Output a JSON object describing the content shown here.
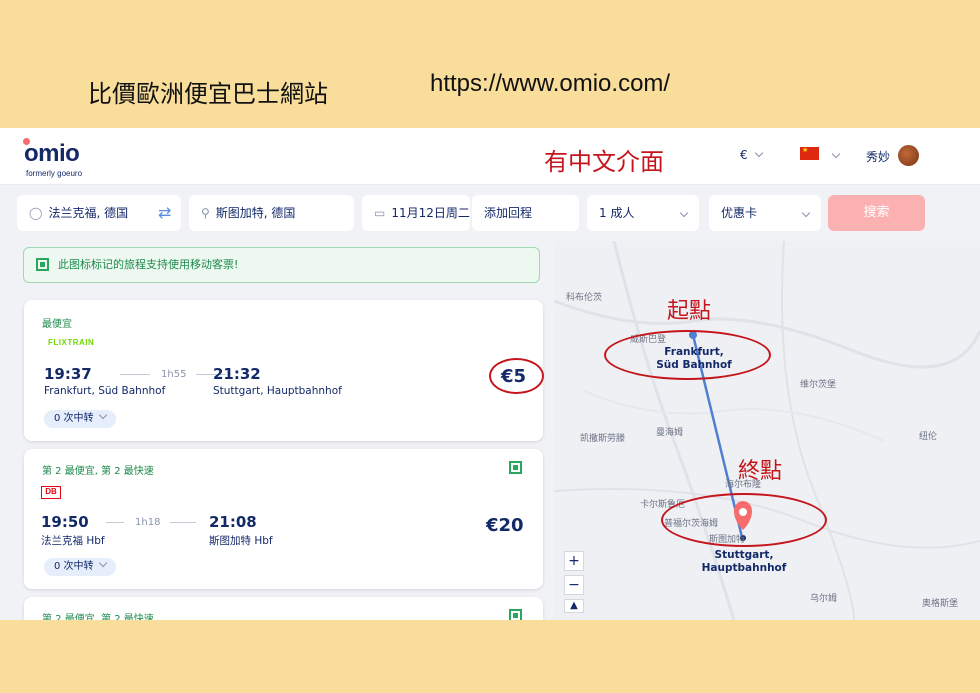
{
  "slide": {
    "title": "比價歐洲便宜巴士網站",
    "url": "https://www.omio.com/"
  },
  "header": {
    "logo": "omio",
    "logo_sub": "formerly goeuro",
    "annotation": "有中文介面",
    "currency": "€",
    "user_name": "秀妙",
    "flag_icon": "china-flag-icon",
    "accent_color": "#132968"
  },
  "search": {
    "from": "法兰克福, 德国",
    "to": "斯图加特, 德国",
    "date": "11月12日周二",
    "return": "添加回程",
    "passengers": "1 成人",
    "discount": "优惠卡",
    "button": "搜索",
    "button_color": "#fbb1b1"
  },
  "notice": "此图标标记的旅程支持使用移动客票!",
  "results": [
    {
      "tag": "最便宜",
      "operator": "FLIXTRAIN",
      "depart_time": "19:37",
      "duration": "1h55",
      "arrive_time": "21:32",
      "depart_station": "Frankfurt, Süd Bahnhof",
      "arrive_station": "Stuttgart, Hauptbahnhof",
      "price": "€5",
      "stops": "0 次中转"
    },
    {
      "tag": "第 2 最便宜, 第 2 最快速",
      "operator": "DB",
      "depart_time": "19:50",
      "duration": "1h18",
      "arrive_time": "21:08",
      "depart_station": "法兰克福 Hbf",
      "arrive_station": "斯图加特 Hbf",
      "price": "€20",
      "stops": "0 次中转"
    },
    {
      "tag": "第 2 最便宜, 第 2 最快速"
    }
  ],
  "map": {
    "labels": [
      "科布伦茨",
      "威斯巴登",
      "维尔茨堡",
      "凯撒斯劳滕",
      "曼海姆",
      "海尔布隆",
      "卡尔斯鲁厄",
      "普福尔茨海姆",
      "斯图加特",
      "乌尔姆",
      "奥格斯堡",
      "纽伦"
    ],
    "start_label_line1": "Frankfurt,",
    "start_label_line2": "Süd Bahnhof",
    "end_label_line1": "Stuttgart,",
    "end_label_line2": "Hauptbahnhof",
    "annotation_start": "起點",
    "annotation_end": "終點",
    "zoom_in": "+",
    "zoom_out": "−"
  }
}
